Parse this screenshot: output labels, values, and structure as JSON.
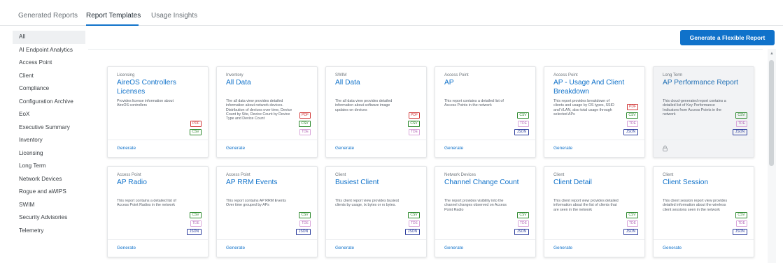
{
  "tabs": [
    "Generated Reports",
    "Report Templates",
    "Usage Insights"
  ],
  "active_tab": 1,
  "sidebar": {
    "items": [
      "All",
      "AI Endpoint Analytics",
      "Access Point",
      "Client",
      "Compliance",
      "Configuration Archive",
      "EoX",
      "Executive Summary",
      "Inventory",
      "Licensing",
      "Long Term",
      "Network Devices",
      "Rogue and aWIPS",
      "SWIM",
      "Security Advisories",
      "Telemetry"
    ],
    "active": "All"
  },
  "generate_flexible_label": "Generate a Flexible Report",
  "generate_label": "Generate",
  "colors": {
    "accent": "#1072ca",
    "pdf": "#d23b3b",
    "csv": "#2f8a2f",
    "tde": "#b66ab8",
    "json": "#2e3f9e"
  },
  "cards": [
    {
      "category": "Licensing",
      "title": "AireOS Controllers Licenses",
      "desc": "Provides license information about AireOS controllers",
      "formats": [
        "PDF",
        "CSV"
      ],
      "locked": false
    },
    {
      "category": "Inventory",
      "title": "All Data",
      "desc": "The all data view provides detailed information about network devices. Distribution of devices over time, Device Count by Site, Device Count by Device Type and Device Count",
      "formats": [
        "PDF",
        "CSV",
        "TDE"
      ],
      "locked": false
    },
    {
      "category": "SWIM",
      "title": "All Data",
      "desc": "The all data view provides detailed information about software image updates on devices",
      "formats": [
        "PDF",
        "CSV",
        "TDE"
      ],
      "locked": false
    },
    {
      "category": "Access Point",
      "title": "AP",
      "desc": "This report contains a detailed list of Access Points in the network",
      "formats": [
        "CSV",
        "TDE",
        "JSON"
      ],
      "locked": false
    },
    {
      "category": "Access Point",
      "title": "AP - Usage And Client Breakdown",
      "desc": "This report provides breakdown of clients and usage by OS types, SSID and VLAN, also total usage through selected APs",
      "formats": [
        "PDF",
        "CSV",
        "TDE",
        "JSON"
      ],
      "locked": false
    },
    {
      "category": "Long Term",
      "title": "AP Performance Report",
      "desc": "This cloud-generated report contains a detailed list of Key Performance Indicators from Access Points in the network",
      "formats": [
        "CSV",
        "TDE",
        "JSON"
      ],
      "locked": true
    },
    {
      "category": "Access Point",
      "title": "AP Radio",
      "desc": "This report contains a detailed list of Access Point Radios in the network",
      "formats": [
        "CSV",
        "TDE",
        "JSON"
      ],
      "locked": false
    },
    {
      "category": "Access Point",
      "title": "AP RRM Events",
      "desc": "This report contains AP RRM Events Over time grouped by APs",
      "formats": [
        "CSV",
        "TDE",
        "JSON"
      ],
      "locked": false
    },
    {
      "category": "Client",
      "title": "Busiest Client",
      "desc": "This client report view provides busiest clients by usage, tx bytes or rx bytes.",
      "formats": [
        "CSV",
        "TDE",
        "JSON"
      ],
      "locked": false
    },
    {
      "category": "Network Devices",
      "title": "Channel Change Count",
      "desc": "The report provides visibility into the channel changes observed on Access Point Radio",
      "formats": [
        "CSV",
        "TDE",
        "JSON"
      ],
      "locked": false
    },
    {
      "category": "Client",
      "title": "Client Detail",
      "desc": "This client report view provides detailed information about the list of clients that are seen in the network",
      "formats": [
        "CSV",
        "TDE",
        "JSON"
      ],
      "locked": false
    },
    {
      "category": "Client",
      "title": "Client Session",
      "desc": "This client session report view provides detailed information about the wireless client sessions seen in the network",
      "formats": [
        "CSV",
        "TDE",
        "JSON"
      ],
      "locked": false
    }
  ]
}
